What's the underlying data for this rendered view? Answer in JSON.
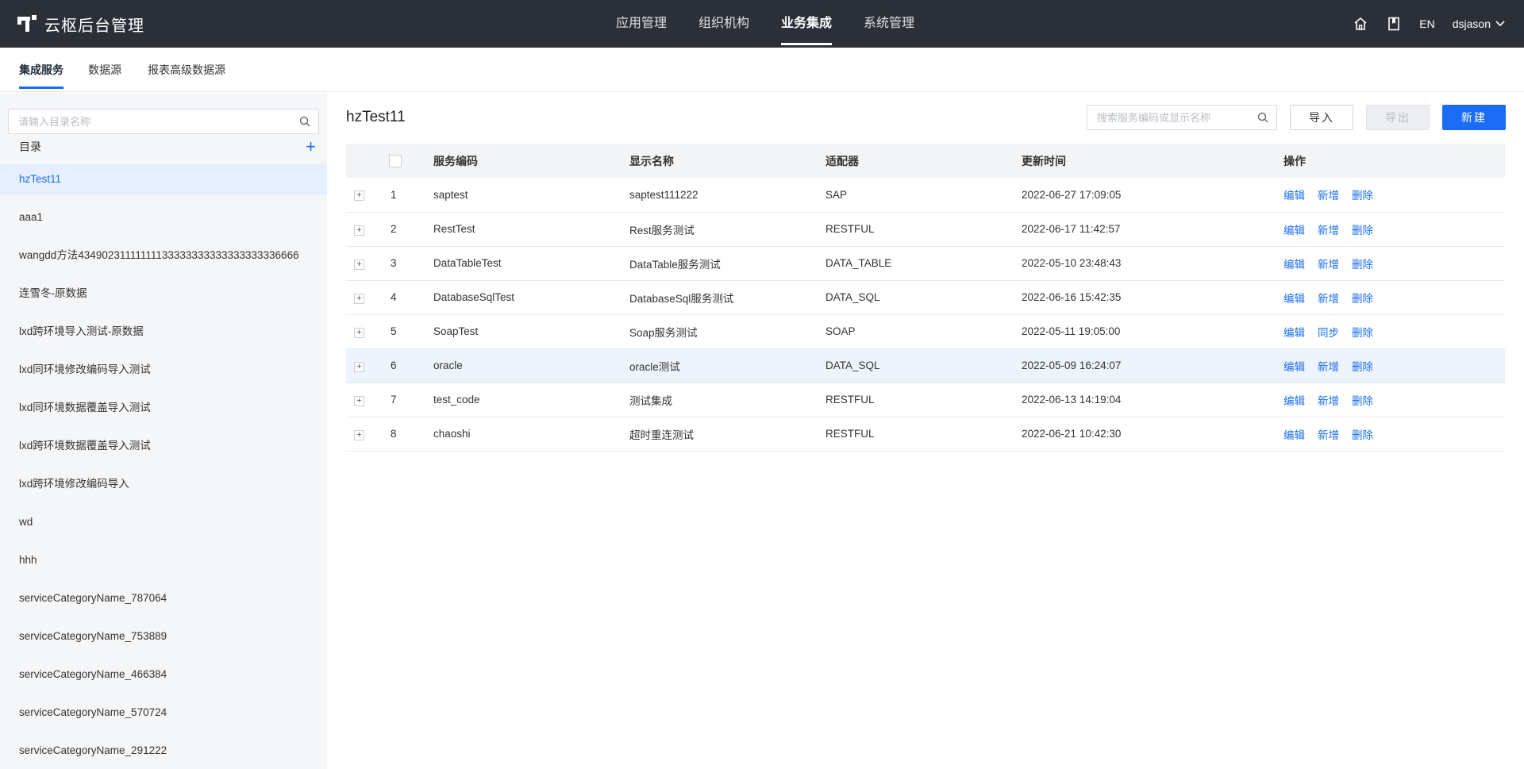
{
  "app": {
    "title": "云枢后台管理"
  },
  "top_nav": [
    {
      "label": "应用管理",
      "active": false
    },
    {
      "label": "组织机构",
      "active": false
    },
    {
      "label": "业务集成",
      "active": true
    },
    {
      "label": "系统管理",
      "active": false
    }
  ],
  "header_right": {
    "lang": "EN",
    "user": "dsjason"
  },
  "sub_tabs": [
    {
      "label": "集成服务",
      "active": true
    },
    {
      "label": "数据源",
      "active": false
    },
    {
      "label": "报表高级数据源",
      "active": false
    }
  ],
  "sidebar": {
    "search_placeholder": "请输入目录名称",
    "dir_label": "目录",
    "add": "+",
    "items": [
      "hzTest11",
      "aaa1",
      "wangdd方法43490231111111133333333333333333336666",
      "连雪冬-原数据",
      "lxd跨环境导入测试-原数据",
      "lxd同环境修改编码导入测试",
      "lxd同环境数据覆盖导入测试",
      "lxd跨环境数据覆盖导入测试",
      "lxd跨环境修改编码导入",
      "wd",
      "hhh",
      "serviceCategoryName_787064",
      "serviceCategoryName_753889",
      "serviceCategoryName_466384",
      "serviceCategoryName_570724",
      "serviceCategoryName_291222"
    ]
  },
  "main": {
    "title": "hzTest11",
    "search_placeholder": "搜索服务编码或显示名称",
    "import_label": "导入",
    "export_label": "导出",
    "new_label": "新建",
    "columns": {
      "code": "服务编码",
      "name": "显示名称",
      "adapter": "适配器",
      "updated": "更新时间",
      "ops": "操作"
    },
    "rows": [
      {
        "idx": "1",
        "code": "saptest",
        "name": "saptest111222",
        "adapter": "SAP",
        "updated": "2022-06-27 17:09:05",
        "op1": "编辑",
        "op2": "新增",
        "op3": "删除"
      },
      {
        "idx": "2",
        "code": "RestTest",
        "name": "Rest服务测试",
        "adapter": "RESTFUL",
        "updated": "2022-06-17 11:42:57",
        "op1": "编辑",
        "op2": "新增",
        "op3": "删除"
      },
      {
        "idx": "3",
        "code": "DataTableTest",
        "name": "DataTable服务测试",
        "adapter": "DATA_TABLE",
        "updated": "2022-05-10 23:48:43",
        "op1": "编辑",
        "op2": "新增",
        "op3": "删除"
      },
      {
        "idx": "4",
        "code": "DatabaseSqlTest",
        "name": "DatabaseSql服务测试",
        "adapter": "DATA_SQL",
        "updated": "2022-06-16 15:42:35",
        "op1": "编辑",
        "op2": "新增",
        "op3": "删除"
      },
      {
        "idx": "5",
        "code": "SoapTest",
        "name": "Soap服务测试",
        "adapter": "SOAP",
        "updated": "2022-05-11 19:05:00",
        "op1": "编辑",
        "op2": "同步",
        "op3": "删除"
      },
      {
        "idx": "6",
        "code": "oracle",
        "name": "oracle测试",
        "adapter": "DATA_SQL",
        "updated": "2022-05-09 16:24:07",
        "op1": "编辑",
        "op2": "新增",
        "op3": "删除"
      },
      {
        "idx": "7",
        "code": "test_code",
        "name": "测试集成",
        "adapter": "RESTFUL",
        "updated": "2022-06-13 14:19:04",
        "op1": "编辑",
        "op2": "新增",
        "op3": "删除"
      },
      {
        "idx": "8",
        "code": "chaoshi",
        "name": "超时重连测试",
        "adapter": "RESTFUL",
        "updated": "2022-06-21 10:42:30",
        "op1": "编辑",
        "op2": "新增",
        "op3": "删除"
      }
    ]
  },
  "colors": {
    "topbar": "#2b3038",
    "accent": "#1a6cf5",
    "sidebar_bg": "#f5f6f8"
  },
  "icons": [
    "logo-icon",
    "home-icon",
    "book-icon",
    "chevron-down-icon",
    "search-icon",
    "plus-icon",
    "expand-icon"
  ]
}
